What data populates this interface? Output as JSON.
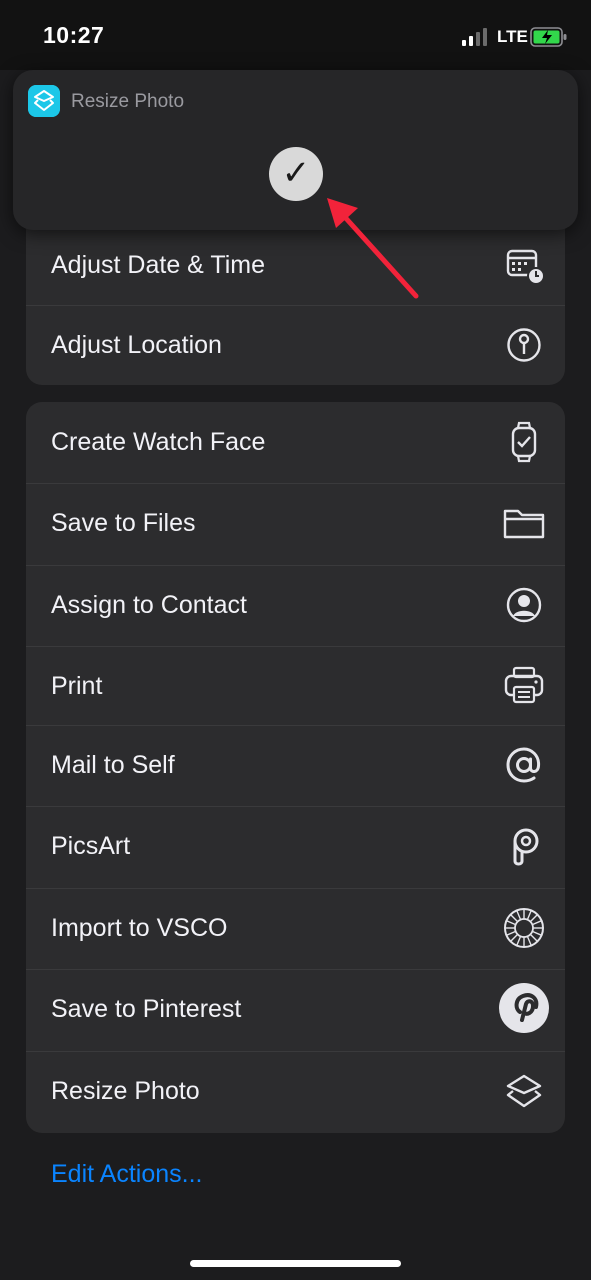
{
  "status": {
    "time": "10:27",
    "network": "LTE"
  },
  "banner": {
    "app_name": "Resize Photo",
    "check": "✓"
  },
  "group1": [
    {
      "label": "Adjust Date & Time",
      "icon": "calendar-clock-icon"
    },
    {
      "label": "Adjust Location",
      "icon": "location-pin-icon"
    }
  ],
  "group2": [
    {
      "label": "Create Watch Face",
      "icon": "watch-icon"
    },
    {
      "label": "Save to Files",
      "icon": "folder-icon"
    },
    {
      "label": "Assign to Contact",
      "icon": "contact-icon"
    },
    {
      "label": "Print",
      "icon": "printer-icon"
    },
    {
      "label": "Mail to Self",
      "icon": "at-sign-icon"
    },
    {
      "label": "PicsArt",
      "icon": "picsart-icon"
    },
    {
      "label": "Import to VSCO",
      "icon": "vsco-icon"
    },
    {
      "label": "Save to Pinterest",
      "icon": "pinterest-icon"
    },
    {
      "label": "Resize Photo",
      "icon": "shortcuts-icon"
    }
  ],
  "edit_actions": "Edit Actions...",
  "colors": {
    "accent": "#0a84ff",
    "arrow": "#f2233a",
    "banner_icon": "#1cc7e8"
  }
}
